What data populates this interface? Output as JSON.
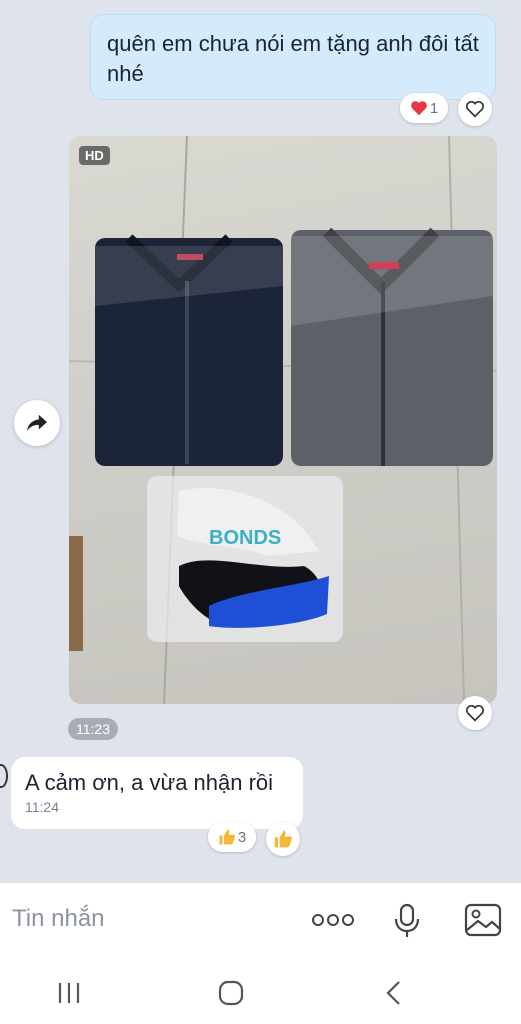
{
  "messages": {
    "outgoing_text": "quên em chưa nói em tặng anh đôi tất nhé",
    "heart_reaction_count": "1",
    "photo_badge": "HD",
    "photo_bonds_text": "BONDS",
    "photo_time": "11:23",
    "incoming_text": "A cảm ơn, a vừa nhận rồi",
    "incoming_time": "11:24",
    "like_reaction_count": "3"
  },
  "composer": {
    "placeholder": "Tin nhắn"
  },
  "colors": {
    "outgoing_bubble": "#d4ebfb",
    "chat_background": "#dfe4ec",
    "heart": "#e53945",
    "like": "#f4b63b"
  }
}
